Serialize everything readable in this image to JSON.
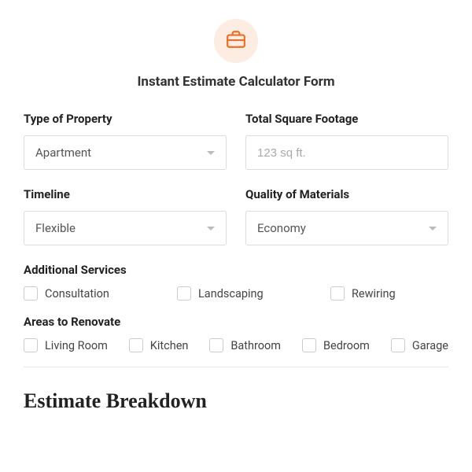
{
  "header": {
    "icon": "briefcase-icon",
    "title": "Instant Estimate Calculator Form"
  },
  "fields": {
    "property_type": {
      "label": "Type of Property",
      "value": "Apartment"
    },
    "square_footage": {
      "label": "Total Square Footage",
      "placeholder": "123 sq ft."
    },
    "timeline": {
      "label": "Timeline",
      "value": "Flexible"
    },
    "materials": {
      "label": "Quality of Materials",
      "value": "Economy"
    }
  },
  "additional_services": {
    "label": "Additional Services",
    "options": [
      "Consultation",
      "Landscaping",
      "Rewiring"
    ]
  },
  "areas": {
    "label": "Areas to Renovate",
    "options": [
      "Living Room",
      "Kitchen",
      "Bathroom",
      "Bedroom",
      "Garage"
    ]
  },
  "breakdown": {
    "title": "Estimate Breakdown"
  },
  "colors": {
    "accent": "#e8702a"
  }
}
